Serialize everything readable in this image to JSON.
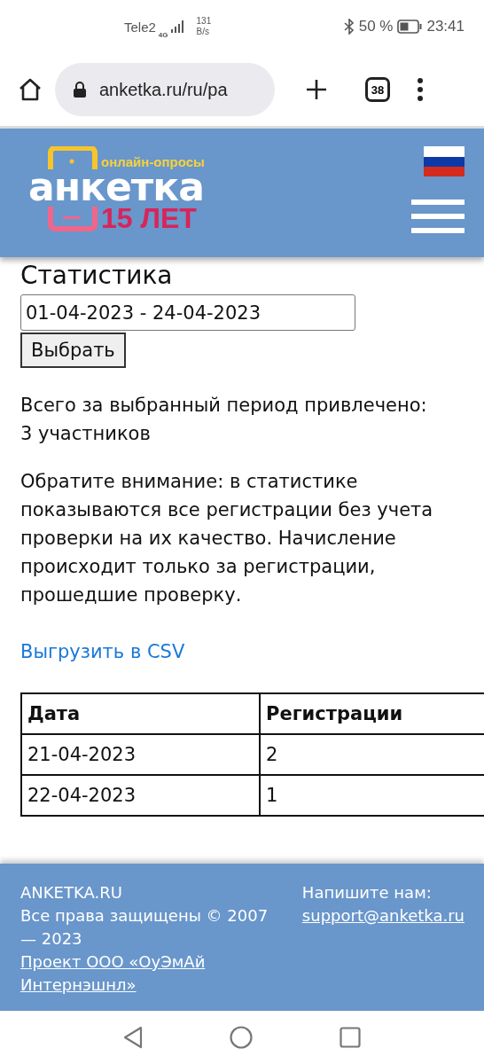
{
  "status_bar": {
    "carrier": "Tele2",
    "network": "4G",
    "speed_value": "131",
    "speed_unit": "B/s",
    "battery": "50 %",
    "time": "23:41"
  },
  "browser": {
    "url": "anketka.ru/ru/pa",
    "tab_count": "38"
  },
  "header": {
    "logo_tagline": "онлайн-опросы",
    "logo_name": "анкетка",
    "logo_years": "15 ЛЕТ"
  },
  "page": {
    "heading": "Статистика",
    "date_range": "01-04-2023 - 24-04-2023",
    "select_button": "Выбрать",
    "total_text": "Всего за выбранный период привлечено:",
    "total_count": "3 участников",
    "notice": "Обратите внимание: в статистике показываются все регистрации без учета проверки на их качество. Начисление происходит только за регистрации, прошедшие проверку.",
    "export_link": "Выгрузить в CSV"
  },
  "table": {
    "columns": [
      "Дата",
      "Регистрации"
    ],
    "rows": [
      [
        "21-04-2023",
        "2"
      ],
      [
        "22-04-2023",
        "1"
      ]
    ]
  },
  "footer": {
    "site": "ANKETKA.RU",
    "copyright": "Все права защищены © 2007 — 2023",
    "company_link": "Проект ООО «ОуЭмАй Интернэшнл»",
    "contact_label": "Напишите нам:",
    "email": "support@anketka.ru"
  }
}
